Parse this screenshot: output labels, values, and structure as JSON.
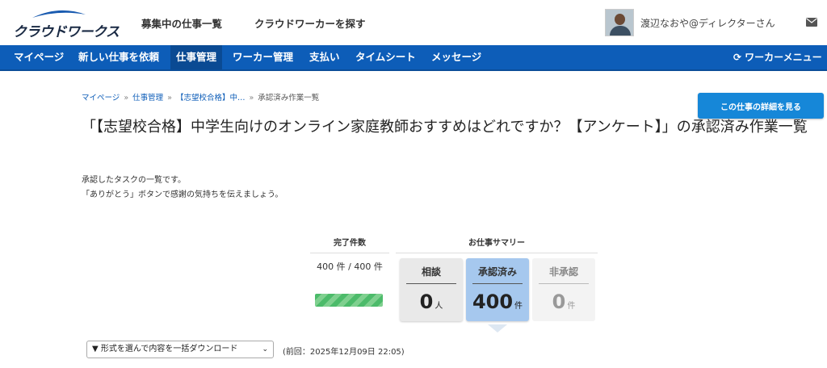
{
  "header": {
    "logo_text": "クラウドワークス",
    "links": [
      "募集中の仕事一覧",
      "クラウドワーカーを探す"
    ],
    "user_name": "渡辺なおや@ディレクターさん"
  },
  "nav": {
    "items": [
      "マイページ",
      "新しい仕事を依頼",
      "仕事管理",
      "ワーカー管理",
      "支払い",
      "タイムシート",
      "メッセージ"
    ],
    "active_index": 2,
    "right_label": "ワーカーメニュー"
  },
  "breadcrumb": [
    "マイページ",
    "仕事管理",
    "【志望校合格】中…",
    "承認済み作業一覧"
  ],
  "detail_button": "この仕事の詳細を見る",
  "title": "「【志望校合格】中学生向けのオンライン家庭教師おすすめはどれですか？【アンケート】」の承認済み作業一覧",
  "description": [
    "承認したタスクの一覧です。",
    "「ありがとう」ボタンで感謝の気持ちを伝えましょう。"
  ],
  "summary": {
    "done_heading": "完了件数",
    "summary_heading": "お仕事サマリー",
    "done_text": "400 件 / 400 件",
    "progress": 1.0,
    "cards": [
      {
        "label": "相談",
        "value": "0",
        "unit": "人"
      },
      {
        "label": "承認済み",
        "value": "400",
        "unit": "件"
      },
      {
        "label": "非承認",
        "value": "0",
        "unit": "件"
      }
    ]
  },
  "download": {
    "select_label": "▼ 形式を選んで内容を一括ダウンロード",
    "last_info": "(前回：2025年12月09日 22:05)"
  },
  "colors": {
    "nav_bg": "#0d5db8",
    "button": "#1687d8",
    "approved_card": "#a6c8ee",
    "progress": "#4cbb6a"
  }
}
